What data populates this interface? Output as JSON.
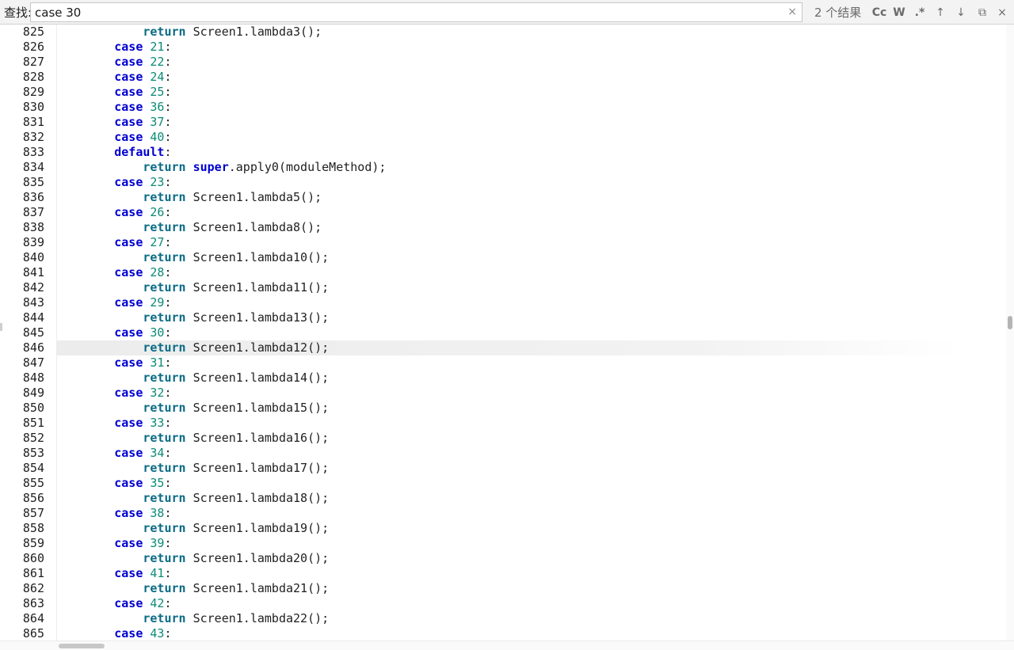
{
  "find_bar": {
    "label": "查找:",
    "query": "case 30",
    "clear_icon": "×",
    "result_count": "2 个结果",
    "tools": [
      {
        "name": "match-case-toggle",
        "glyph": "Cc"
      },
      {
        "name": "whole-word-toggle",
        "glyph": "W"
      },
      {
        "name": "regex-toggle",
        "glyph": ".*"
      },
      {
        "name": "previous-result-button",
        "glyph": "↑"
      },
      {
        "name": "next-result-button",
        "glyph": "↓"
      },
      {
        "name": "find-in-selection-button",
        "glyph": "⧉"
      },
      {
        "name": "close-find-button",
        "glyph": "×"
      }
    ]
  },
  "editor": {
    "current_line": "846",
    "lines": [
      {
        "n": "825",
        "indent": "            ",
        "kind": "ret",
        "text": "Screen1.lambda3();"
      },
      {
        "n": "826",
        "indent": "        ",
        "kind": "case",
        "num": "21"
      },
      {
        "n": "827",
        "indent": "        ",
        "kind": "case",
        "num": "22"
      },
      {
        "n": "828",
        "indent": "        ",
        "kind": "case",
        "num": "24"
      },
      {
        "n": "829",
        "indent": "        ",
        "kind": "case",
        "num": "25"
      },
      {
        "n": "830",
        "indent": "        ",
        "kind": "case",
        "num": "36"
      },
      {
        "n": "831",
        "indent": "        ",
        "kind": "case",
        "num": "37"
      },
      {
        "n": "832",
        "indent": "        ",
        "kind": "case",
        "num": "40"
      },
      {
        "n": "833",
        "indent": "        ",
        "kind": "default"
      },
      {
        "n": "834",
        "indent": "            ",
        "kind": "super",
        "text": ".apply0(moduleMethod);"
      },
      {
        "n": "835",
        "indent": "        ",
        "kind": "case",
        "num": "23"
      },
      {
        "n": "836",
        "indent": "            ",
        "kind": "ret",
        "text": "Screen1.lambda5();"
      },
      {
        "n": "837",
        "indent": "        ",
        "kind": "case",
        "num": "26"
      },
      {
        "n": "838",
        "indent": "            ",
        "kind": "ret",
        "text": "Screen1.lambda8();"
      },
      {
        "n": "839",
        "indent": "        ",
        "kind": "case",
        "num": "27"
      },
      {
        "n": "840",
        "indent": "            ",
        "kind": "ret",
        "text": "Screen1.lambda10();"
      },
      {
        "n": "841",
        "indent": "        ",
        "kind": "case",
        "num": "28"
      },
      {
        "n": "842",
        "indent": "            ",
        "kind": "ret",
        "text": "Screen1.lambda11();"
      },
      {
        "n": "843",
        "indent": "        ",
        "kind": "case",
        "num": "29"
      },
      {
        "n": "844",
        "indent": "            ",
        "kind": "ret",
        "text": "Screen1.lambda13();"
      },
      {
        "n": "845",
        "indent": "        ",
        "kind": "case",
        "num": "30"
      },
      {
        "n": "846",
        "indent": "            ",
        "kind": "ret",
        "text": "Screen1.lambda12();"
      },
      {
        "n": "847",
        "indent": "        ",
        "kind": "case",
        "num": "31"
      },
      {
        "n": "848",
        "indent": "            ",
        "kind": "ret",
        "text": "Screen1.lambda14();"
      },
      {
        "n": "849",
        "indent": "        ",
        "kind": "case",
        "num": "32"
      },
      {
        "n": "850",
        "indent": "            ",
        "kind": "ret",
        "text": "Screen1.lambda15();"
      },
      {
        "n": "851",
        "indent": "        ",
        "kind": "case",
        "num": "33"
      },
      {
        "n": "852",
        "indent": "            ",
        "kind": "ret",
        "text": "Screen1.lambda16();"
      },
      {
        "n": "853",
        "indent": "        ",
        "kind": "case",
        "num": "34"
      },
      {
        "n": "854",
        "indent": "            ",
        "kind": "ret",
        "text": "Screen1.lambda17();"
      },
      {
        "n": "855",
        "indent": "        ",
        "kind": "case",
        "num": "35"
      },
      {
        "n": "856",
        "indent": "            ",
        "kind": "ret",
        "text": "Screen1.lambda18();"
      },
      {
        "n": "857",
        "indent": "        ",
        "kind": "case",
        "num": "38"
      },
      {
        "n": "858",
        "indent": "            ",
        "kind": "ret",
        "text": "Screen1.lambda19();"
      },
      {
        "n": "859",
        "indent": "        ",
        "kind": "case",
        "num": "39"
      },
      {
        "n": "860",
        "indent": "            ",
        "kind": "ret",
        "text": "Screen1.lambda20();"
      },
      {
        "n": "861",
        "indent": "        ",
        "kind": "case",
        "num": "41"
      },
      {
        "n": "862",
        "indent": "            ",
        "kind": "ret",
        "text": "Screen1.lambda21();"
      },
      {
        "n": "863",
        "indent": "        ",
        "kind": "case",
        "num": "42"
      },
      {
        "n": "864",
        "indent": "            ",
        "kind": "ret",
        "text": "Screen1.lambda22();"
      },
      {
        "n": "865",
        "indent": "        ",
        "kind": "case",
        "num": "43"
      }
    ]
  },
  "keywords": {
    "case": "case",
    "default": "default",
    "return": "return",
    "super": "super",
    "colon": ":"
  },
  "colors": {
    "keyword": "#0000d0",
    "return_keyword": "#0b6b85",
    "number": "#0b8a76",
    "text": "#1f1f1f"
  }
}
